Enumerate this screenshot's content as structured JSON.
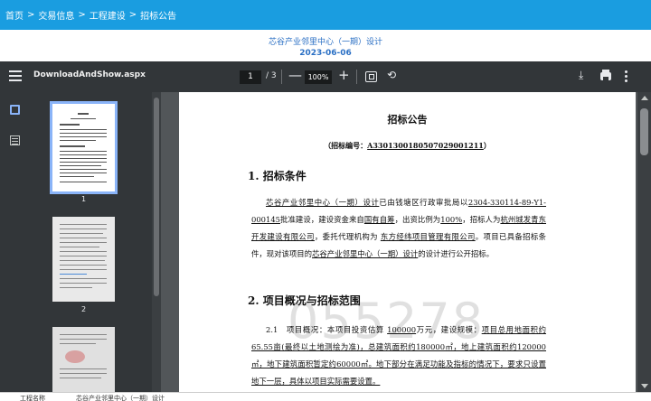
{
  "breadcrumb": [
    "首页",
    ">",
    "交易信息",
    ">",
    "工程建设",
    ">",
    "招标公告"
  ],
  "header": {
    "project_title": "芯谷产业邻里中心（一期）设计",
    "date": "2023-06-06"
  },
  "viewer": {
    "filename": "DownloadAndShow.aspx",
    "current_page": "1",
    "total_pages": "/ 3",
    "zoom_minus": "—",
    "zoom": "100%",
    "zoom_plus": "+",
    "thumbnails": [
      {
        "label": "1",
        "selected": true
      },
      {
        "label": "2",
        "selected": false
      }
    ]
  },
  "icons": {
    "menu": "menu-icon",
    "fit": "fit-page-icon",
    "rotate": "rotate-icon",
    "download": "download-icon",
    "print": "print-icon",
    "more": "more-vert-icon",
    "thumbnails": "thumbnails-icon",
    "outline": "outline-icon"
  },
  "document": {
    "title": "招标公告",
    "code_prefix": "（招标编号：",
    "code_value": "A3301300180507029001211",
    "code_suffix": "）",
    "section1_heading": "1.  招标条件",
    "section1_text": [
      {
        "t": "芯谷产业邻里中心（一期）设计",
        "u": true
      },
      {
        "t": "已由钱塘区行政审批局以",
        "u": false
      },
      {
        "t": "2304-330114-89-Y1-000145",
        "u": true
      },
      {
        "t": "批准建设，建设资金来自",
        "u": false
      },
      {
        "t": "国有自筹",
        "u": true
      },
      {
        "t": "，出资比例为",
        "u": false
      },
      {
        "t": "100%",
        "u": true
      },
      {
        "t": "，招标人为",
        "u": false
      },
      {
        "t": "杭州城发青东开发建设有限公司",
        "u": true
      },
      {
        "t": "，委托代理机构为 ",
        "u": false
      },
      {
        "t": "东方经纬项目管理有限公司",
        "u": true
      },
      {
        "t": "。项目已具备招标条件，现对该项目的",
        "u": false
      },
      {
        "t": "芯谷产业邻里中心（一期）设计",
        "u": true
      },
      {
        "t": "的设计进行公开招标。",
        "u": false
      }
    ],
    "section2_heading": "2.  项目概况与招标范围",
    "section2_text": [
      {
        "t": "2.1　项目概况：本项目投资估算 ",
        "u": false
      },
      {
        "t": "100000",
        "u": true
      },
      {
        "t": "万元，建设规模：",
        "u": false
      },
      {
        "t": "项目总用地面积约 65.55亩(最终以土地测绘为准)，总建筑面积约180000㎡，地上建筑面积约120000㎡，地下建筑面积暂定约60000㎡。地下部分在满足功能及指标的情况下，要求只设置地下一层，具体以项目实际需要设置。",
        "u": true
      }
    ],
    "watermark": "055278"
  },
  "footer": {
    "label": "工程名称",
    "value": "芯谷产业邻里中心（一期）设计"
  }
}
